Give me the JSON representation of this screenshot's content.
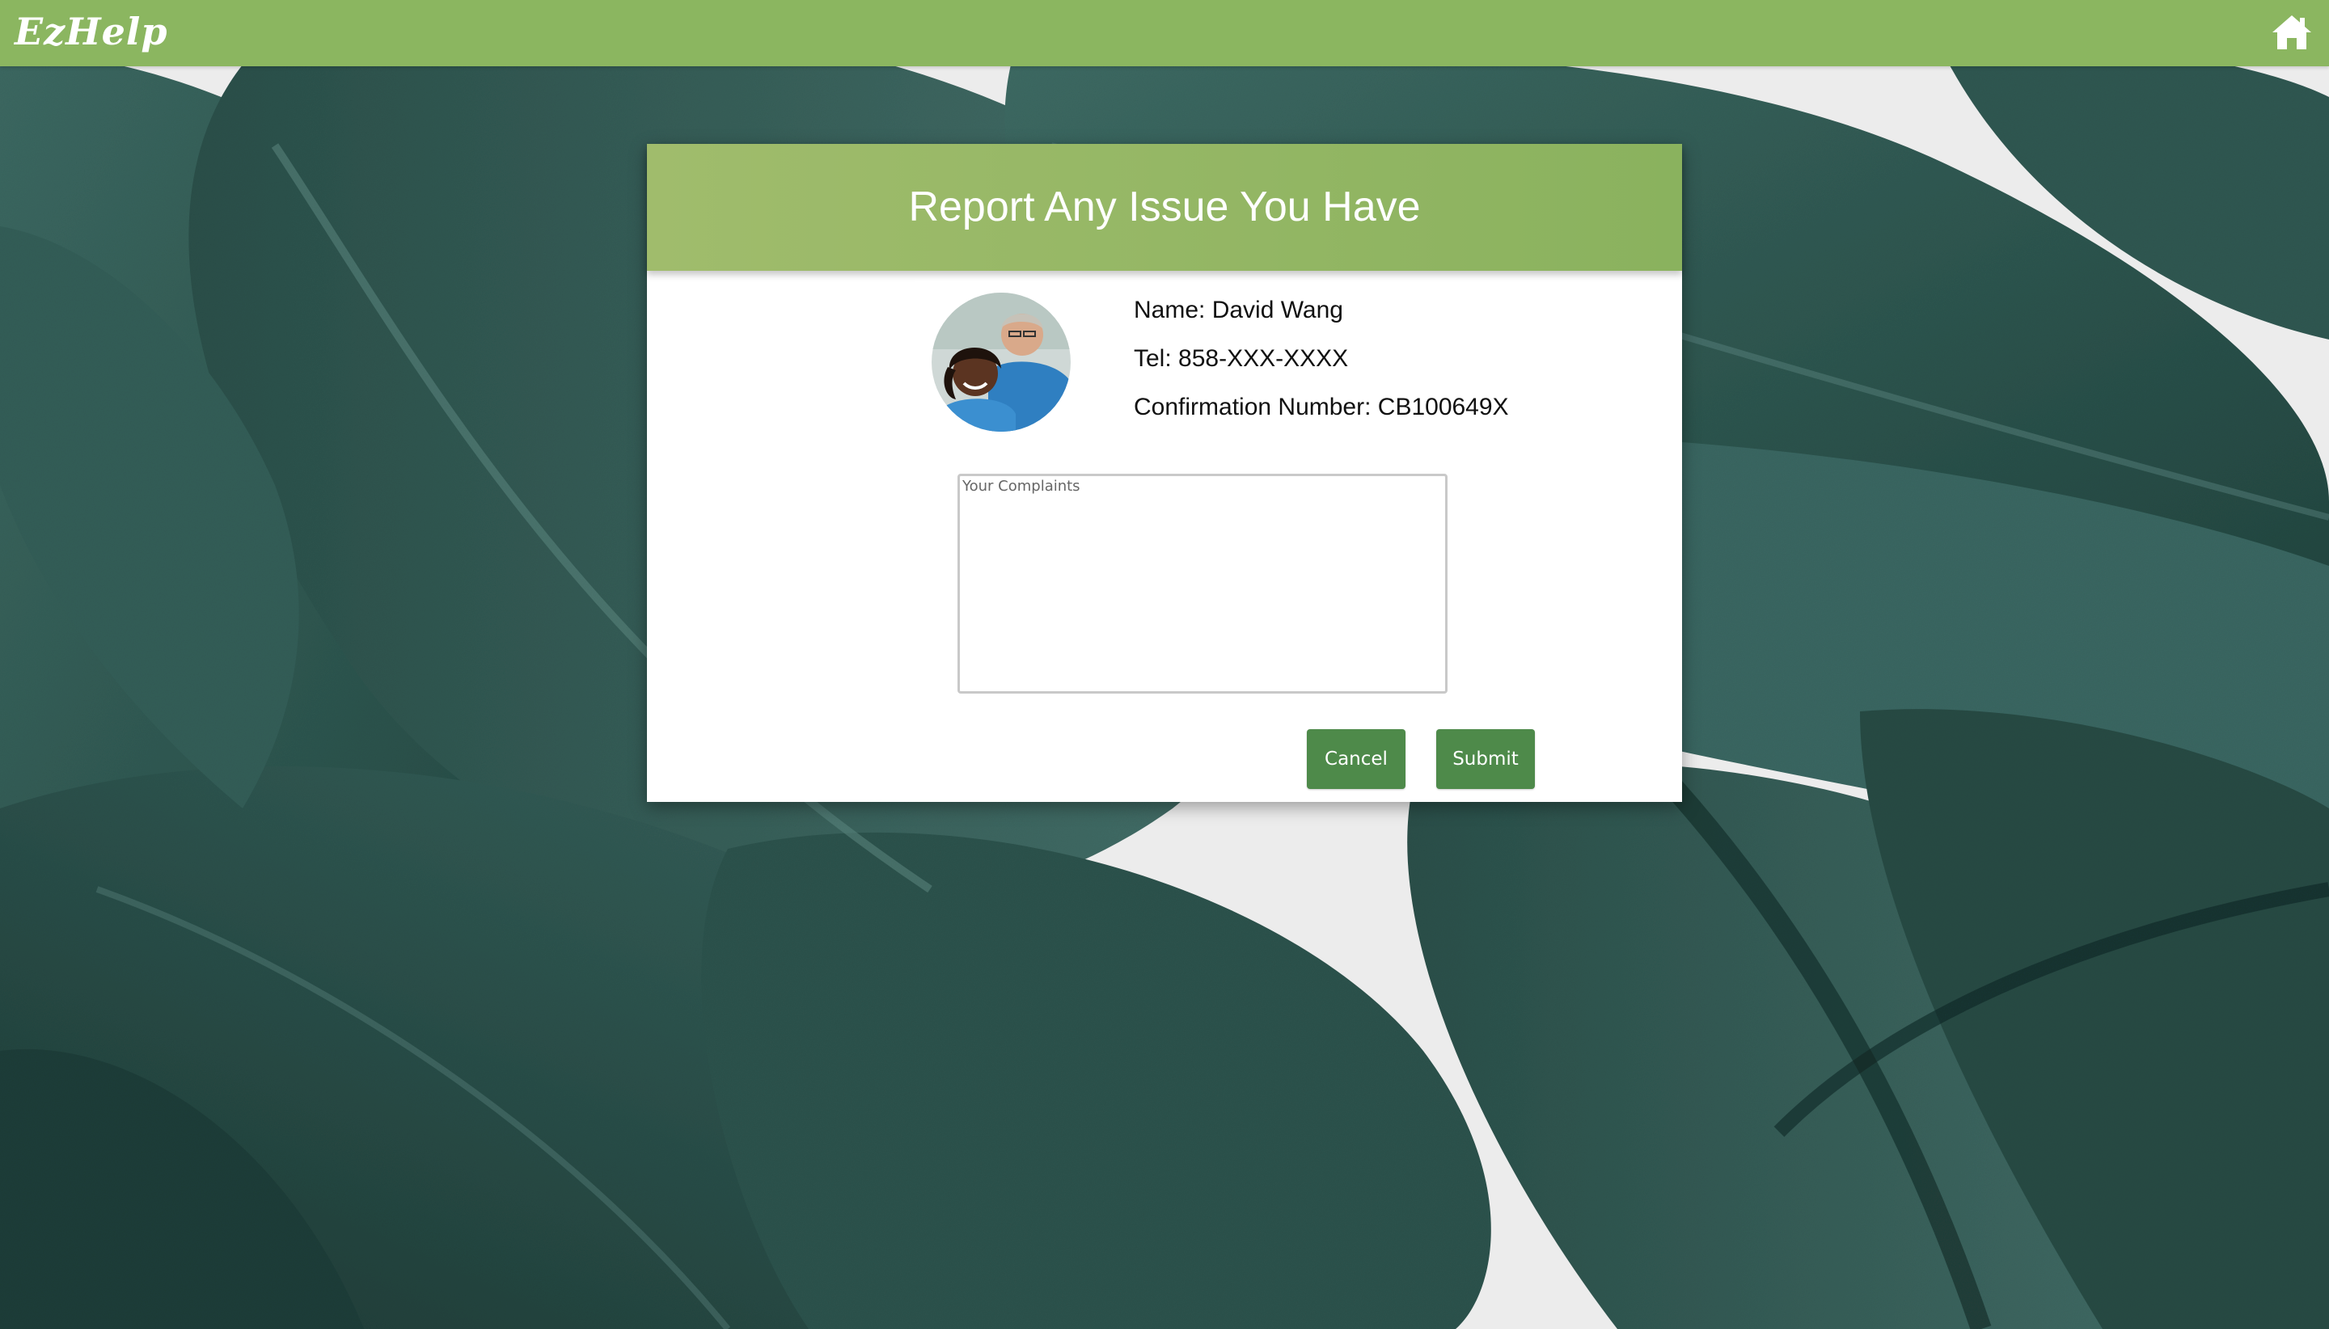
{
  "app": {
    "logo_text": "EzHelp",
    "home_icon": "home-icon"
  },
  "modal": {
    "title": "Report Any Issue You Have",
    "avatar_icon": "volunteers-photo",
    "name_line": "Name: David Wang",
    "tel_line": "Tel: 858-XXX-XXXX",
    "confirmation_line": "Confirmation Number: CB100649X",
    "complaints": {
      "placeholder": "Your Complaints",
      "value": ""
    },
    "cancel_label": "Cancel",
    "submit_label": "Submit"
  },
  "colors": {
    "topbar": "#8bb660",
    "header_start": "#a0bc6c",
    "header_end": "#8ab25e",
    "button": "#4e8a4a",
    "leaf_dark": "#22453f",
    "leaf_mid": "#3b6660",
    "background_light": "#ebeceb"
  }
}
